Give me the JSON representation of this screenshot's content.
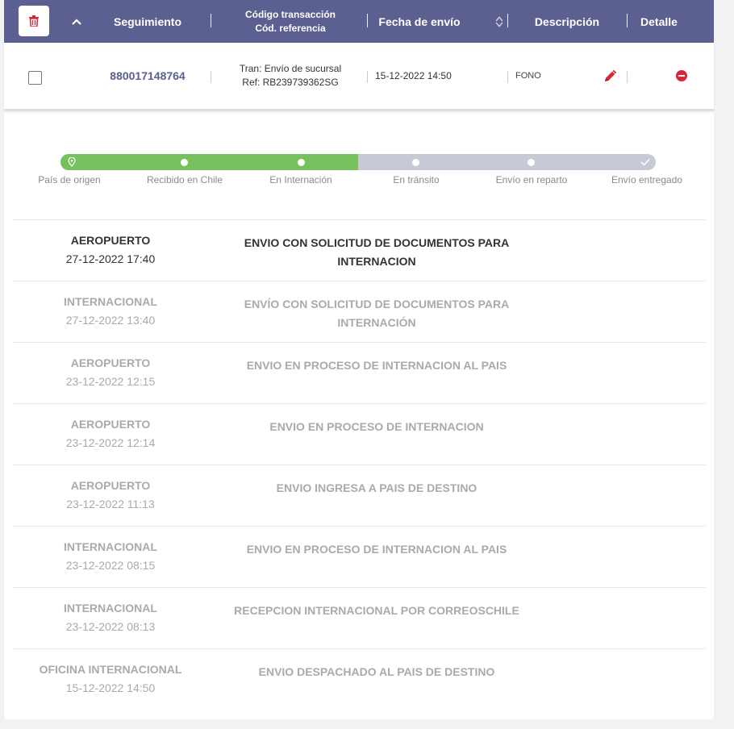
{
  "header": {
    "seguimiento": "Seguimiento",
    "codigo_line1": "Código transacción",
    "codigo_line2": "Cód. referencia",
    "fecha": "Fecha de envío",
    "descripcion": "Descripción",
    "detalle": "Detalle",
    "sort_icon": "sort-arrows-icon",
    "collapse_icon": "chevron-up-icon",
    "delete_icon": "trash-icon"
  },
  "order": {
    "tracking": "880017148764",
    "transaction": "Tran: Envío de sucursal",
    "reference": "Ref: RB239739362SG",
    "date": "15-12-2022 14:50",
    "description": "FONO",
    "edit_icon": "pencil-icon",
    "remove_icon": "minus-circle-icon"
  },
  "progress": {
    "completed_steps": 3,
    "steps": [
      {
        "label": "País de origen",
        "icon": "map-pin-icon"
      },
      {
        "label": "Recibido en Chile",
        "icon": "dot-icon"
      },
      {
        "label": "En Internación",
        "icon": "dot-icon"
      },
      {
        "label": "En tránsito",
        "icon": "dot-icon"
      },
      {
        "label": "Envío en reparto",
        "icon": "dot-icon"
      },
      {
        "label": "Envío entregado",
        "icon": "check-icon"
      }
    ]
  },
  "events": [
    {
      "location": "AEROPUERTO",
      "datetime": "27-12-2022 17:40",
      "desc_line1": "ENVIO CON SOLICITUD DE DOCUMENTOS PARA",
      "desc_line2": "INTERNACION"
    },
    {
      "location": "INTERNACIONAL",
      "datetime": "27-12-2022 13:40",
      "desc_line1": "ENVÍO CON SOLICITUD DE DOCUMENTOS PARA",
      "desc_line2": "INTERNACIÓN"
    },
    {
      "location": "AEROPUERTO",
      "datetime": "23-12-2022 12:15",
      "desc_line1": "ENVIO EN PROCESO DE INTERNACION AL PAIS",
      "desc_line2": ""
    },
    {
      "location": "AEROPUERTO",
      "datetime": "23-12-2022 12:14",
      "desc_line1": "ENVIO EN PROCESO DE INTERNACION",
      "desc_line2": ""
    },
    {
      "location": "AEROPUERTO",
      "datetime": "23-12-2022 11:13",
      "desc_line1": "ENVIO INGRESA A PAIS DE DESTINO",
      "desc_line2": ""
    },
    {
      "location": "INTERNACIONAL",
      "datetime": "23-12-2022 08:15",
      "desc_line1": "ENVIO EN PROCESO DE INTERNACION AL PAIS",
      "desc_line2": ""
    },
    {
      "location": "INTERNACIONAL",
      "datetime": "23-12-2022 08:13",
      "desc_line1": "RECEPCION INTERNACIONAL POR CORREOSCHILE",
      "desc_line2": ""
    },
    {
      "location": "OFICINA INTERNACIONAL",
      "datetime": "15-12-2022 14:50",
      "desc_line1": "ENVIO DESPACHADO AL PAIS DE DESTINO",
      "desc_line2": ""
    }
  ],
  "colors": {
    "header_bg": "#5b6090",
    "progress_done": "#76c15e",
    "progress_todo": "#c7cad6",
    "danger": "#d9263a"
  }
}
